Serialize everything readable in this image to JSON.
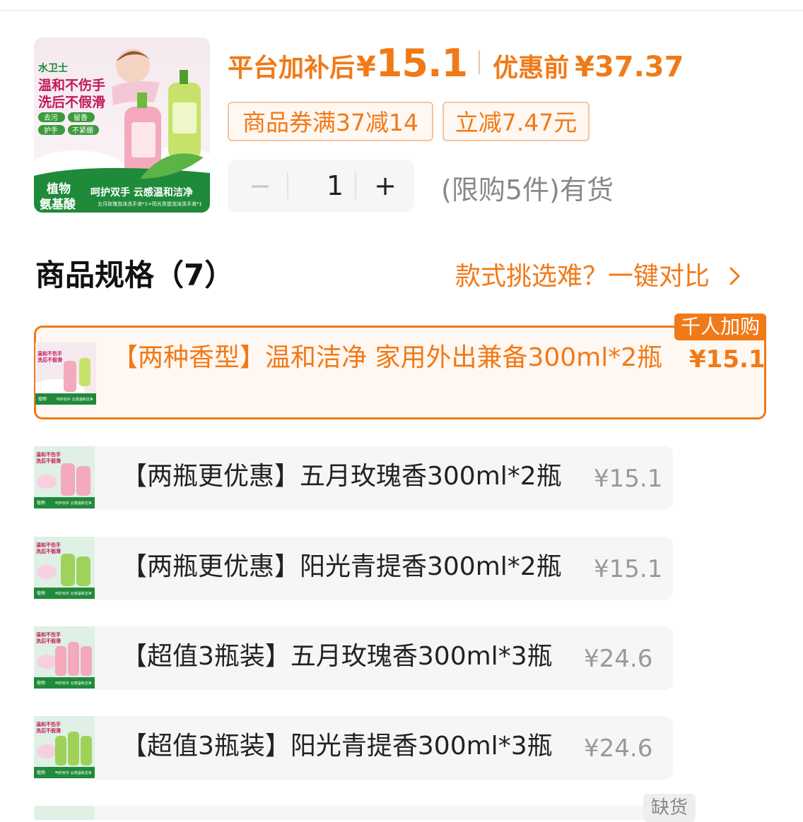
{
  "product": {
    "image_alt": "水卫士 泡沫洗手液 产品图",
    "price_label": "平台加补后",
    "price_symbol": "¥",
    "price_value": "15.1",
    "original_label": "优惠前",
    "original_value": "¥37.37",
    "coupons": [
      "商品券满37减14",
      "立减7.47元"
    ],
    "quantity": "1",
    "minus": "−",
    "plus": "+",
    "stock_text": "(限购5件)有货",
    "thumb_text": {
      "brand": "水卫士",
      "line1": "温和不伤手",
      "line2": "洗后不假滑",
      "tags": [
        "去污",
        "留香",
        "护手",
        "不紧绷"
      ],
      "badge_line1": "植物",
      "badge_line2": "氨基酸",
      "slogan": "呵护双手 云感温和洁净",
      "small": "五月玫瑰泡沫洗手液*1+阳光青提泡沫洗手液*1"
    }
  },
  "specs": {
    "title": "商品规格（7）",
    "compare_label": "款式挑选难？一键对比",
    "compare_icon": "chevron-right-icon",
    "items": [
      {
        "name": "【两种香型】温和洁净 家用外出兼备300ml*2瓶",
        "price": "¥15.1",
        "badge": "千人加购",
        "selected": true,
        "type": "mix"
      },
      {
        "name": "【两瓶更优惠】五月玫瑰香300ml*2瓶",
        "price": "¥15.1",
        "type": "pink"
      },
      {
        "name": "【两瓶更优惠】阳光青提香300ml*2瓶",
        "price": "¥15.1",
        "type": "green"
      },
      {
        "name": "【超值3瓶装】五月玫瑰香300ml*3瓶",
        "price": "¥24.6",
        "type": "pink"
      },
      {
        "name": "【超值3瓶装】阳光青提香300ml*3瓶",
        "price": "¥24.6",
        "type": "green"
      }
    ],
    "out_of_stock": "缺货"
  },
  "colors": {
    "accent": "#f07a18",
    "price_text": "#f07a18",
    "muted": "#999999",
    "selected_bg": "#fff7f1"
  }
}
